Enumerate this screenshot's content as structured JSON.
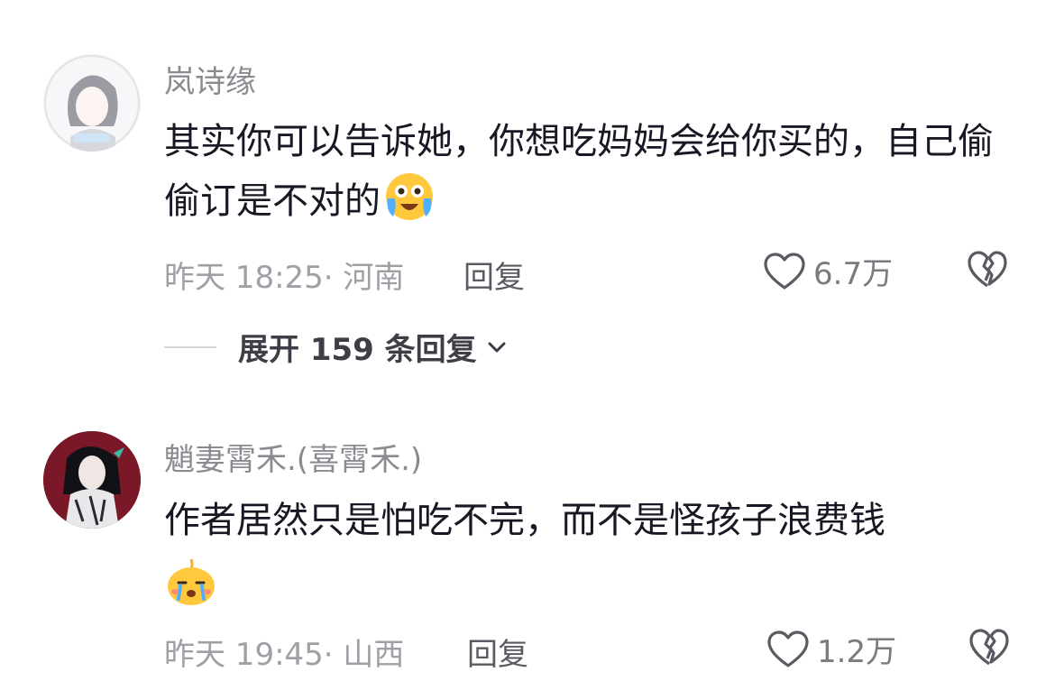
{
  "comments": [
    {
      "username": "岚诗缘",
      "text": "其实你可以告诉她，你想吃妈妈会给你买的，自己偷偷订是不对的",
      "emoji": "laugh-cry-emoji",
      "time": "昨天 18:25",
      "location": "河南",
      "reply_label": "回复",
      "likes": "6.7万"
    },
    {
      "username": "魈妻霄禾.(喜霄禾.)",
      "text": "作者居然只是怕吃不完，而不是怪孩子浪费钱",
      "emoji": "crying-chick-emoji",
      "time": "昨天 19:45",
      "location": "山西",
      "reply_label": "回复",
      "likes": "1.2万"
    }
  ],
  "expand_replies": "展开 159 条回复",
  "colors": {
    "text": "#161823",
    "muted": "#9fa0a6",
    "username": "#8a8b91"
  }
}
